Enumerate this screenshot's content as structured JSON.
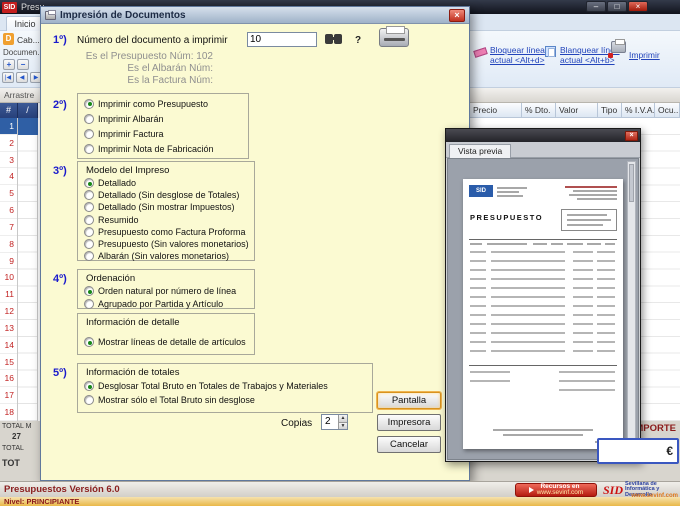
{
  "icons": {
    "minimize": "–",
    "maximize": "□",
    "close": "×",
    "up": "▲",
    "down": "▼"
  },
  "colors": {
    "dialog_bg": "#fbfad2",
    "selection_blue": "#2f5fa5",
    "close_red": "#c03030",
    "brand_red": "#cc1111",
    "link_blue": "#2244bb"
  },
  "main_window": {
    "titlebar": {
      "app_badge": "SID",
      "title": "Presu..."
    },
    "tabs": {
      "inicio": "Inicio"
    },
    "left_panel": {
      "doc_icon": "D",
      "cab_tab": "Cab...",
      "documento_label": "Documen...",
      "small_buttons": [
        "+",
        "−"
      ],
      "nav_buttons": [
        "|◀",
        "◀",
        "▶"
      ]
    },
    "toolbar": {
      "item1_line1": "Bloquear línea",
      "item1_line2": "actual <Alt+d>",
      "item2_line1": "Blanquear línea",
      "item2_line2": "actual <Alt+b>",
      "item3_label": "Imprimir"
    },
    "group_bar": "Arrastre",
    "grid": {
      "hash_header": "#",
      "slash_header": "/",
      "columns": [
        "Precio",
        "% Dto.",
        "Valor",
        "Tipo",
        "% I.V.A.",
        "Ocu..."
      ],
      "row_numbers": [
        "1",
        "2",
        "3",
        "4",
        "5",
        "6",
        "7",
        "8",
        "9",
        "10",
        "11",
        "12",
        "13",
        "14",
        "15",
        "16",
        "17",
        "18"
      ],
      "selected_row": "1"
    },
    "totals": {
      "line1": "TOTAL M",
      "value1": "27",
      "line2": "TOTAL",
      "line3": "TOT",
      "importe_label": "IMPORTE",
      "importe_value": "€"
    },
    "statusbar": {
      "version": "Presupuestos Versión 6.0",
      "resources_line1": "Recursos en",
      "resources_line2": "www.sevinf.com",
      "sid_name": "SID",
      "sid_line1": "Sevillana de",
      "sid_line2": "Informática y",
      "sid_line3": "Desarrollo",
      "sid_url": "www.sevinf.com"
    },
    "levelbar": "Nivel: PRINCIPIANTE"
  },
  "dialog": {
    "title": "Impresión de Documentos",
    "sections": [
      "1º)",
      "2º)",
      "3º)",
      "4º)",
      "5º)"
    ],
    "doc_number": {
      "label": "Número del documento a imprimir",
      "value": "10",
      "help": "?"
    },
    "info_lines": [
      "Es el Presupuesto Núm: 102",
      "Es el Albarán Núm:",
      "Es la Factura Núm:"
    ],
    "print_as": {
      "options": [
        {
          "label": "Imprimir como Presupuesto",
          "checked": true
        },
        {
          "label": "Imprimir Albarán",
          "checked": false
        },
        {
          "label": "Imprimir Factura",
          "checked": false
        },
        {
          "label": "Imprimir Nota de Fabricación",
          "checked": false
        }
      ]
    },
    "model": {
      "label": "Modelo del Impreso",
      "options": [
        {
          "label": "Detallado",
          "checked": true
        },
        {
          "label": "Detallado (Sin desglose de Totales)",
          "checked": false
        },
        {
          "label": "Detallado (Sin mostrar Impuestos)",
          "checked": false
        },
        {
          "label": "Resumido",
          "checked": false
        },
        {
          "label": "Presupuesto como Factura Proforma",
          "checked": false
        },
        {
          "label": "Presupuesto (Sin valores monetarios)",
          "checked": false
        },
        {
          "label": "Albarán (Sin valores monetarios)",
          "checked": false
        }
      ]
    },
    "ordering": {
      "label": "Ordenación",
      "options": [
        {
          "label": "Orden natural por número de línea",
          "checked": true
        },
        {
          "label": "Agrupado por Partida y Artículo",
          "checked": false
        }
      ]
    },
    "detail": {
      "label": "Información de detalle",
      "options": [
        {
          "label": "Mostrar líneas de detalle de artículos",
          "checked": true
        }
      ]
    },
    "totals_info": {
      "label": "Información de totales",
      "options": [
        {
          "label": "Desglosar Total Bruto en Totales de Trabajos y Materiales",
          "checked": true
        },
        {
          "label": "Mostrar sólo el Total Bruto sin desglose",
          "checked": false
        }
      ]
    },
    "copies": {
      "label": "Copias",
      "value": "2"
    },
    "buttons": {
      "screen": "Pantalla",
      "printer": "Impresora",
      "cancel": "Cancelar"
    }
  },
  "preview": {
    "tab": "Vista previa",
    "doc_title": "PRESUPUESTO",
    "logo": "SID"
  }
}
